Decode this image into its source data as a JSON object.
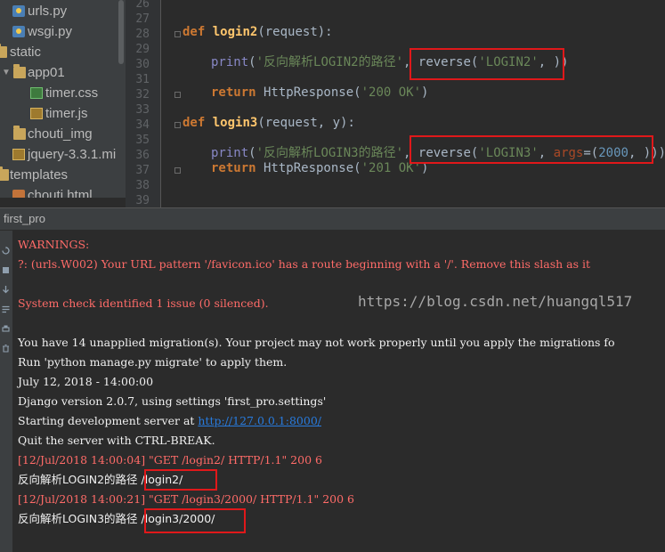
{
  "project_tree": {
    "items": [
      {
        "label": "urls.py",
        "icon": "python-file-icon"
      },
      {
        "label": "wsgi.py",
        "icon": "python-file-icon"
      },
      {
        "label": "static",
        "icon": "folder-icon"
      },
      {
        "label": "app01",
        "icon": "folder-icon"
      },
      {
        "label": "timer.css",
        "icon": "css-file-icon"
      },
      {
        "label": "timer.js",
        "icon": "js-file-icon"
      },
      {
        "label": "chouti_img",
        "icon": "folder-icon"
      },
      {
        "label": "jquery-3.3.1.mi",
        "icon": "js-file-icon"
      },
      {
        "label": "templates",
        "icon": "folder-icon"
      },
      {
        "label": "chouti.html",
        "icon": "html-file-icon"
      }
    ]
  },
  "editor": {
    "line_numbers": [
      "26",
      "27",
      "28",
      "29",
      "30",
      "31",
      "32",
      "33",
      "34",
      "35",
      "36",
      "37",
      "38",
      "39"
    ],
    "code": {
      "l28": {
        "kw": "def",
        "fn": "login2",
        "rest": "(request):"
      },
      "l30": {
        "print": "print",
        "open": "(",
        "str": "'反向解析LOGIN2的路径'",
        "comma": ", ",
        "reverse": "reverse",
        "open2": "(",
        "arg": "'LOGIN2'",
        "close": ", ))"
      },
      "l32": {
        "kw": "return",
        "call": " HttpResponse(",
        "str": "'200 OK'",
        "close": ")"
      },
      "l34": {
        "kw": "def",
        "fn": "login3",
        "rest": "(request, y):"
      },
      "l36": {
        "print": "print",
        "open": "(",
        "str": "'反向解析LOGIN3的路径'",
        "comma": ", ",
        "reverse": "reverse",
        "open2": "(",
        "arg": "'LOGIN3'",
        "comma2": ", ",
        "named": "args",
        "eq": "=(",
        "num": "2000",
        "close": ", )))"
      },
      "l37": {
        "kw": "return",
        "call": " HttpResponse(",
        "str": "'201 OK'",
        "close": ")"
      }
    }
  },
  "run_panel": {
    "title": "first_pro"
  },
  "console": {
    "lines": [
      {
        "text": "WARNINGS:",
        "color": "#ff6b68"
      },
      {
        "text": "?: (urls.W002) Your URL pattern '/favicon.ico' has a route beginning with a '/'. Remove this slash as it",
        "color": "#ff6b68"
      },
      {
        "text": "",
        "color": "#ff6b68"
      },
      {
        "text": "System check identified 1 issue (0 silenced).",
        "color": "#ff6b68"
      },
      {
        "text": "",
        "color": "#f0f0f0"
      },
      {
        "text": "You have 14 unapplied migration(s). Your project may not work properly until you apply the migrations fo",
        "color": "#f0f0f0"
      },
      {
        "text": "Run 'python manage.py migrate' to apply them.",
        "color": "#f0f0f0"
      },
      {
        "text": "July 12, 2018 - 14:00:00",
        "color": "#f0f0f0"
      },
      {
        "text": "Django version 2.0.7, using settings 'first_pro.settings'",
        "color": "#f0f0f0"
      },
      {
        "text": "Starting development server at ",
        "color": "#f0f0f0",
        "link": "http://127.0.0.1:8000/"
      },
      {
        "text": "Quit the server with CTRL-BREAK.",
        "color": "#f0f0f0"
      },
      {
        "text": "[12/Jul/2018 14:00:04] \"GET /login2/ HTTP/1.1\" 200 6",
        "color": "#ff6b68"
      },
      {
        "text": "反向解析LOGIN2的路径 /login2/",
        "color": "#f0f0f0"
      },
      {
        "text": "[12/Jul/2018 14:00:21] \"GET /login3/2000/ HTTP/1.1\" 200 6",
        "color": "#ff6b68"
      },
      {
        "text": "反向解析LOGIN3的路径 /login3/2000/",
        "color": "#f0f0f0"
      }
    ],
    "watermark": "https://blog.csdn.net/huangql517"
  },
  "colors": {
    "highlight_box": "#e0181a",
    "editor_bg": "#2b2b2b",
    "panel_bg": "#3c3f41",
    "error_text": "#ff6b68",
    "link": "#287bde"
  }
}
